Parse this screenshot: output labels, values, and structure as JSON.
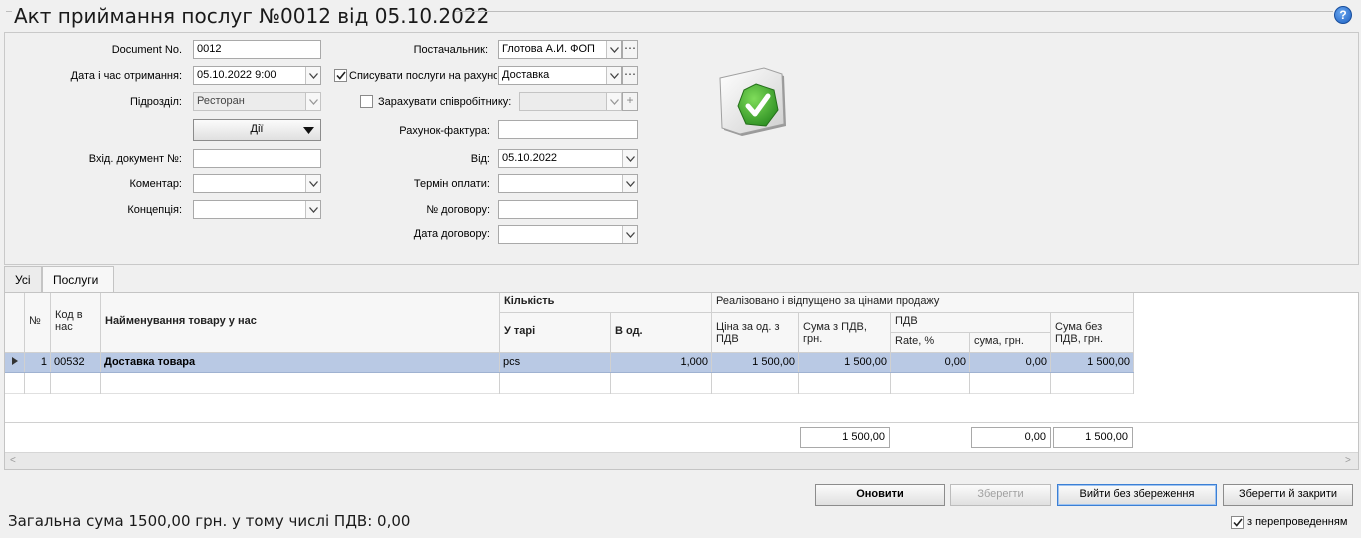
{
  "window": {
    "title": "Акт приймання послуг №0012 від 05.10.2022",
    "help_icon": "?"
  },
  "form": {
    "document_no": {
      "label": "Document No.",
      "value": "0012"
    },
    "received_at": {
      "label": "Дата і час отримання:",
      "value": "05.10.2022 9:00"
    },
    "department": {
      "label": "Підрозділ:",
      "value": "Ресторан"
    },
    "actions_button": "Дії",
    "incoming_doc": {
      "label": "Вхід. документ №:",
      "value": ""
    },
    "comment": {
      "label": "Коментар:",
      "value": ""
    },
    "concept": {
      "label": "Концепція:",
      "value": ""
    },
    "supplier": {
      "label": "Постачальник:",
      "value": "Глотова А.И. ФОП"
    },
    "writeoff": {
      "label": "Списувати послуги на рахунок:",
      "checked": true,
      "value": "Доставка"
    },
    "credit_employee": {
      "label": "Зарахувати співробітнику:",
      "checked": false,
      "value": ""
    },
    "invoice": {
      "label": "Рахунок-фактура:",
      "value": ""
    },
    "from_date": {
      "label": "Від:",
      "value": "05.10.2022"
    },
    "payment_term": {
      "label": "Термін оплати:",
      "value": ""
    },
    "contract_no": {
      "label": "№ договору:",
      "value": ""
    },
    "contract_date": {
      "label": "Дата договору:",
      "value": ""
    },
    "status_icon": "document-approved-icon"
  },
  "tabs": [
    {
      "label": "Усі",
      "active": false
    },
    {
      "label": "Послуги",
      "active": true
    }
  ],
  "grid": {
    "headers": {
      "no": "№",
      "code": "Код в нас",
      "name": "Найменування товару у нас",
      "quantity": "Кількість",
      "in_pack": "У тарі",
      "in_units": "В од.",
      "sold_group": "Реалізовано і відпущено за цінами продажу",
      "price_vat": "Ціна за од. з ПДВ",
      "sum_vat": "Сума з ПДВ, грн.",
      "vat": "ПДВ",
      "rate": "Rate, %",
      "vat_sum": "сума, грн.",
      "sum_no_vat": "Сума без ПДВ, грн."
    },
    "rows": [
      {
        "no": "1",
        "code": "00532",
        "name": "Доставка товара",
        "in_pack": "pcs",
        "in_units": "1,000",
        "price_vat": "1 500,00",
        "sum_vat": "1 500,00",
        "rate": "0,00",
        "vat_sum": "0,00",
        "sum_no_vat": "1 500,00"
      }
    ],
    "totals": {
      "sum_vat": "1 500,00",
      "vat_sum": "0,00",
      "sum_no_vat": "1 500,00"
    }
  },
  "buttons": {
    "refresh": "Оновити",
    "save": "Зберегти",
    "exit_no_save": "Вийти без збереження",
    "save_close": "Зберегти й закрити"
  },
  "footer": {
    "total_text": "Загальна сума 1500,00 грн. у тому числі ПДВ: 0,00",
    "repost_label": "з перепроведенням",
    "repost_checked": true
  },
  "colors": {
    "selected_row": "#b9c9e4",
    "status_green": "#3aa835"
  }
}
